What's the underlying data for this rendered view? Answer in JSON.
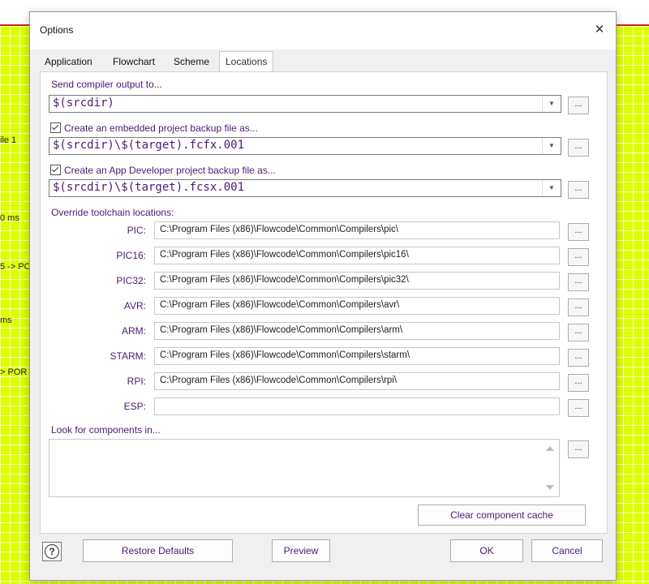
{
  "background": {
    "snippets": [
      "ile 1",
      "0 ms",
      "5 -> PO",
      "ms",
      "> POR"
    ]
  },
  "dialog": {
    "title": "Options",
    "close_glyph": "✕"
  },
  "tabs": [
    {
      "label": "Application"
    },
    {
      "label": "Flowchart"
    },
    {
      "label": "Scheme"
    },
    {
      "label": "Locations",
      "active": true
    }
  ],
  "compiler_output": {
    "label": "Send compiler output to...",
    "value": "$(srcdir)"
  },
  "embedded_backup": {
    "label": "Create an embedded project backup file as...",
    "checked": true,
    "value": "$(srcdir)\\$(target).fcfx.001"
  },
  "appdev_backup": {
    "label": "Create an App Developer project backup file as...",
    "checked": true,
    "value": "$(srcdir)\\$(target).fcsx.001"
  },
  "toolchain": {
    "heading": "Override toolchain locations:",
    "rows": [
      {
        "label": "PIC:",
        "path": "C:\\Program Files (x86)\\Flowcode\\Common\\Compilers\\pic\\"
      },
      {
        "label": "PIC16:",
        "path": "C:\\Program Files (x86)\\Flowcode\\Common\\Compilers\\pic16\\"
      },
      {
        "label": "PIC32:",
        "path": "C:\\Program Files (x86)\\Flowcode\\Common\\Compilers\\pic32\\"
      },
      {
        "label": "AVR:",
        "path": "C:\\Program Files (x86)\\Flowcode\\Common\\Compilers\\avr\\"
      },
      {
        "label": "ARM:",
        "path": "C:\\Program Files (x86)\\Flowcode\\Common\\Compilers\\arm\\"
      },
      {
        "label": "STARM:",
        "path": "C:\\Program Files (x86)\\Flowcode\\Common\\Compilers\\starm\\"
      },
      {
        "label": "RPI:",
        "path": "C:\\Program Files (x86)\\Flowcode\\Common\\Compilers\\rpi\\"
      },
      {
        "label": "ESP:",
        "path": ""
      }
    ]
  },
  "components": {
    "label": "Look for components in...",
    "clear_cache_label": "Clear component cache"
  },
  "browse_label": "...",
  "footer": {
    "help_glyph": "?",
    "restore_defaults": "Restore Defaults",
    "preview": "Preview",
    "ok": "OK",
    "cancel": "Cancel"
  },
  "colors": {
    "accent_text": "#4b1a72",
    "canvas_green": "#ddff00",
    "canvas_red_line": "#d02020"
  }
}
